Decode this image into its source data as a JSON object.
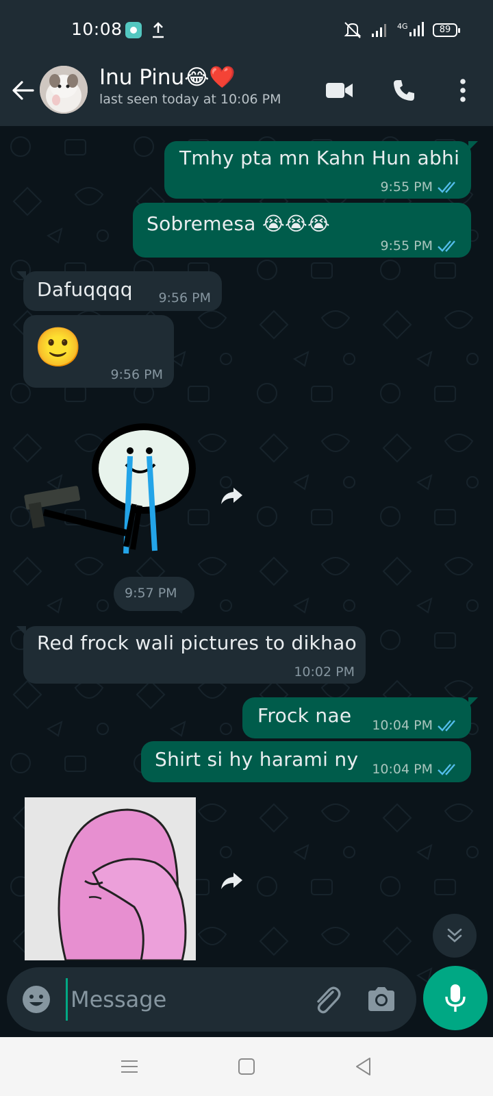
{
  "status_bar": {
    "time": "10:08",
    "network": "4G",
    "battery": "89"
  },
  "header": {
    "contact_name": "Inu Pinu😂❤️",
    "last_seen": "last seen today at 10:06 PM",
    "icons": [
      "back-arrow-icon",
      "video-call-icon",
      "voice-call-icon",
      "more-options-icon"
    ]
  },
  "messages": [
    {
      "direction": "outgoing",
      "text": "Tmhy pta mn Kahn Hun abhi",
      "time": "9:55 PM",
      "status": "read"
    },
    {
      "direction": "outgoing",
      "text": "Sobremesa 😭😭😭",
      "time": "9:55 PM",
      "status": "read"
    },
    {
      "direction": "incoming",
      "text": "Dafuqqqq",
      "time": "9:56 PM"
    },
    {
      "direction": "incoming",
      "text": "🙂",
      "time": "9:56 PM"
    },
    {
      "direction": "incoming",
      "type": "sticker",
      "sticker": "crying-stick-figure-with-gun",
      "time": "9:57 PM"
    },
    {
      "direction": "incoming",
      "text": "Red frock wali pictures to dikhao",
      "time": "10:02 PM"
    },
    {
      "direction": "outgoing",
      "text": "Frock nae",
      "time": "10:04 PM",
      "status": "read"
    },
    {
      "direction": "outgoing",
      "text": "Shirt si hy harami ny",
      "time": "10:04 PM",
      "status": "read"
    },
    {
      "direction": "incoming",
      "type": "sticker",
      "sticker": "pink-wojak-facepalm"
    }
  ],
  "composer": {
    "placeholder": "Message",
    "value": ""
  },
  "colors": {
    "header_bg": "#1f2c34",
    "chat_bg": "#0b141a",
    "outgoing_bubble": "#005c4b",
    "incoming_bubble": "#1f2c34",
    "read_ticks": "#53bdeb",
    "accent": "#00a884",
    "nav_bg": "#f5f5f5"
  }
}
